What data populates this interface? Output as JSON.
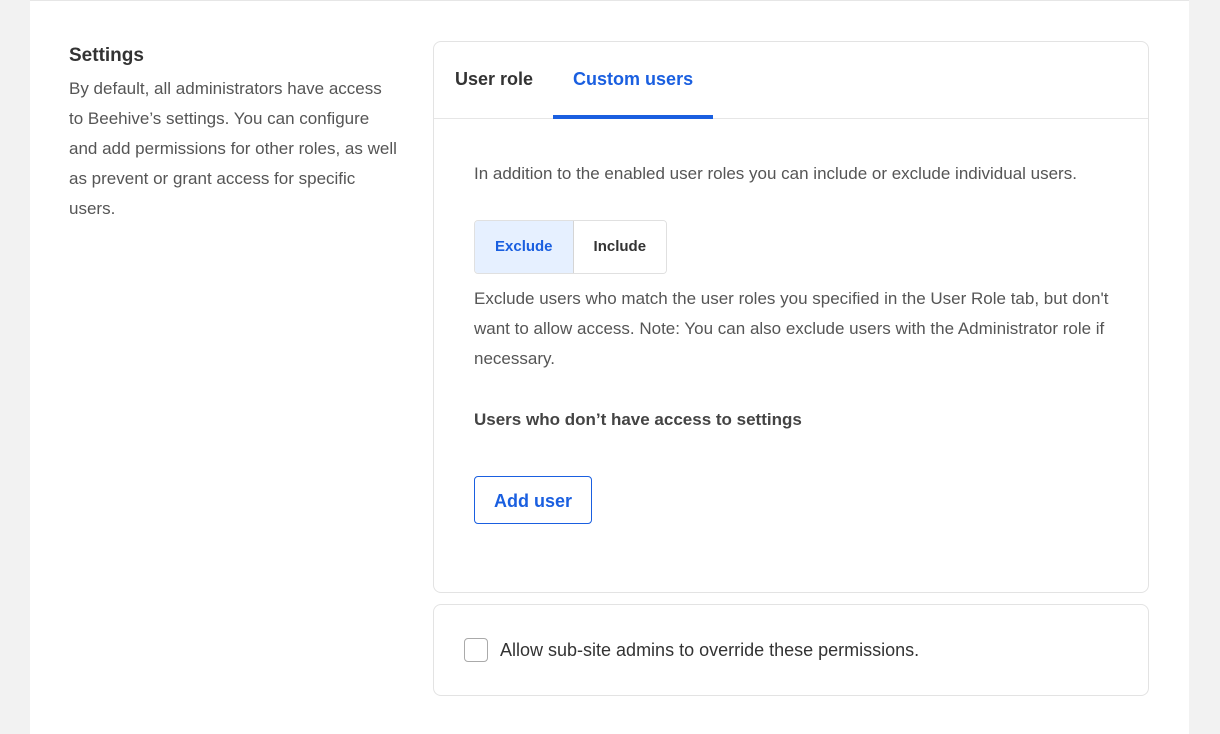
{
  "settings": {
    "title": "Settings",
    "description": "By default, all administrators have access to Beehive’s settings. You can configure and add permissions for other roles, as well as prevent or grant access for specific users."
  },
  "tabs": [
    {
      "label": "User role",
      "active": false
    },
    {
      "label": "Custom users",
      "active": true
    }
  ],
  "custom_users": {
    "intro": "In addition to the enabled user roles you can include or exclude individual users.",
    "segment": {
      "options": [
        "Exclude",
        "Include"
      ],
      "selected": "Exclude"
    },
    "exclude_description": "Exclude users who match the user roles you specified in the User Role tab, but don't want to allow access. Note: You can also exclude users with the Administrator role if necessary.",
    "list_heading": "Users who don’t have access to settings",
    "add_user_label": "Add user"
  },
  "override": {
    "label": "Allow sub-site admins to override these permissions.",
    "checked": false
  },
  "colors": {
    "accent": "#1a5fe0",
    "selected_segment_bg": "#e6f0ff",
    "page_bg": "#f2f2f2"
  }
}
